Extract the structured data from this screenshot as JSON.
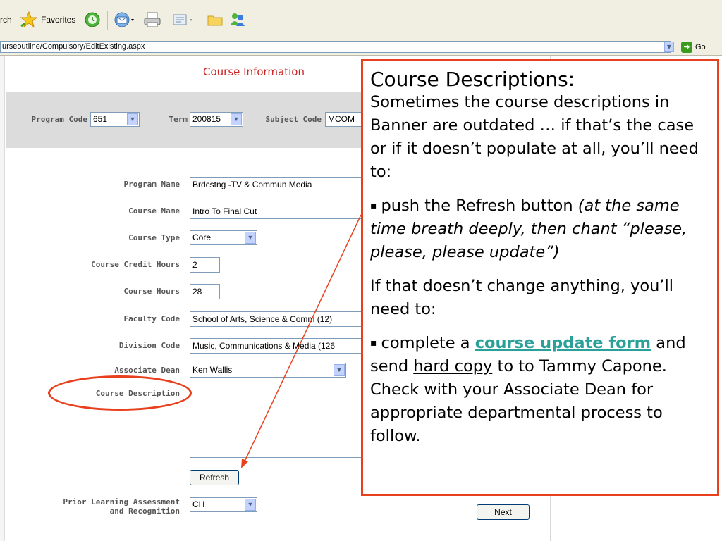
{
  "toolbar": {
    "search_label": "rch",
    "favorites_label": "Favorites"
  },
  "address": {
    "url": "urseoutline/Compulsory/EditExisting.aspx",
    "go_label": "Go"
  },
  "form": {
    "title": "Course Information",
    "program_code": {
      "label": "Program Code",
      "value": "651"
    },
    "term": {
      "label": "Term",
      "value": "200815"
    },
    "subject_code": {
      "label": "Subject Code",
      "value": "MCOM"
    },
    "program_name": {
      "label": "Program Name",
      "value": "Brdcstng -TV & Commun  Media"
    },
    "course_name": {
      "label": "Course Name",
      "value": "Intro To Final Cut"
    },
    "course_type": {
      "label": "Course Type",
      "value": "Core"
    },
    "course_credit_hours": {
      "label": "Course Credit Hours",
      "value": "2"
    },
    "course_hours": {
      "label": "Course Hours",
      "value": "28"
    },
    "faculty_code": {
      "label": "Faculty Code",
      "value": "School of Arts, Science & Comm (12)"
    },
    "division_code": {
      "label": "Division Code",
      "value": "Music, Communications & Media (126"
    },
    "associate_dean": {
      "label": "Associate Dean",
      "value": "Ken Wallis"
    },
    "course_description": {
      "label": "Course Description",
      "value": ""
    },
    "refresh_label": "Refresh",
    "prior_learning": {
      "label_line1": "Prior Learning Assessment",
      "label_line2": "and Recognition",
      "value": "CH"
    },
    "next_label": "Next"
  },
  "callout": {
    "title": "Course Descriptions:",
    "intro": "Sometimes the course descriptions in Banner are outdated … if that’s the case or if it doesn’t populate at all, you’ll need to:",
    "bullet1_text": "push the Refresh button ",
    "bullet1_italic": "(at the same time breath deeply, then chant “please, please, please update”)",
    "middle": "If that doesn’t change anything, you’ll need to:",
    "bullet2_a": "complete a ",
    "bullet2_link": "course update form",
    "bullet2_b": " and send ",
    "bullet2_underline": "hard copy",
    "bullet2_c": " to to Tammy Capone.  Check with your Associate Dean for appropriate departmental process to follow."
  },
  "colors": {
    "annotation_red": "#e8401c",
    "link_teal": "#2aa198",
    "title_red": "#cc2222"
  }
}
